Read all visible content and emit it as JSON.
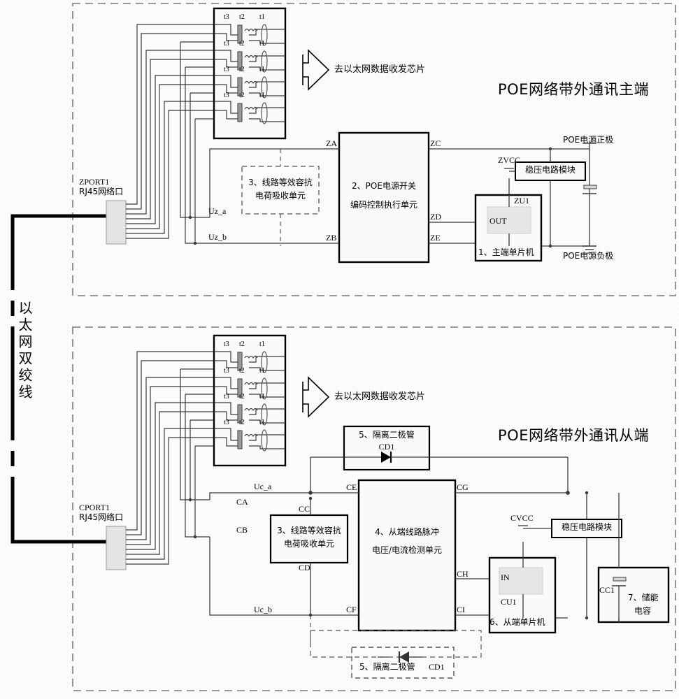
{
  "diagram": {
    "title_top": "POE网络带外通讯主端",
    "title_bottom": "POE网络带外通讯从端",
    "cable_label": "以太网双绞线",
    "arrow_label_top": "去以太网数据收发芯片",
    "arrow_label_bottom": "去以太网数据收发芯片"
  },
  "top": {
    "port": {
      "ref": "ZPORT1",
      "desc": "RJ45网络口"
    },
    "magnetics": {
      "taps": [
        "t3",
        "t2",
        "t1"
      ],
      "rows": 4
    },
    "absorb_unit": {
      "index": "3、",
      "line1": "3、线路等效容抗",
      "line2": "电荷吸收单元"
    },
    "switch_unit": {
      "line1": "2、POE电源开关",
      "line2": "编码控制执行单元"
    },
    "mcu": {
      "label": "1、主端单片机",
      "ref": "ZU1",
      "pin": "OUT"
    },
    "regulator": {
      "label": "稳压电路模块",
      "rail": "ZVCC"
    },
    "power": {
      "positive": "POE电源正极",
      "negative": "POE电源负极"
    },
    "nets": {
      "uz_a": "Uz_a",
      "uz_b": "Uz_b",
      "za": "ZA",
      "zb": "ZB",
      "zc": "ZC",
      "zd": "ZD",
      "ze": "ZE"
    }
  },
  "bottom": {
    "port": {
      "ref": "CPORT1",
      "desc": "RJ45网络口"
    },
    "magnetics": {
      "taps": [
        "t3",
        "t2",
        "t1"
      ],
      "rows": 4
    },
    "absorb_unit": {
      "line1": "3、线路等效容抗",
      "line2": "电荷吸收单元"
    },
    "detect_unit": {
      "line1": "4、从端线路脉冲",
      "line2": "电压/电流检测单元"
    },
    "diode_top": {
      "label": "5、隔离二极管",
      "ref": "CD1"
    },
    "diode_bottom": {
      "label": "5、隔离二极管",
      "ref": "CD1"
    },
    "mcu": {
      "label": "6、从端单片机",
      "ref": "CU1",
      "pin": "IN"
    },
    "regulator": {
      "label": "稳压电路模块",
      "rail": "CVCC"
    },
    "storage_cap": {
      "ref": "CC1",
      "line1": "7、储能",
      "line2": "电容"
    },
    "nets": {
      "uc_a": "Uc_a",
      "uc_b": "Uc_b",
      "ca": "CA",
      "cb": "CB",
      "cc": "CC",
      "cd": "CD",
      "ce": "CE",
      "cf": "CF",
      "cg": "CG",
      "ch": "CH",
      "ci": "CI"
    }
  },
  "colors": {
    "line": "#3a3a3a",
    "heavy": "#000000",
    "fill_light": "#e8e8e8",
    "background": "#fdfdfd"
  }
}
